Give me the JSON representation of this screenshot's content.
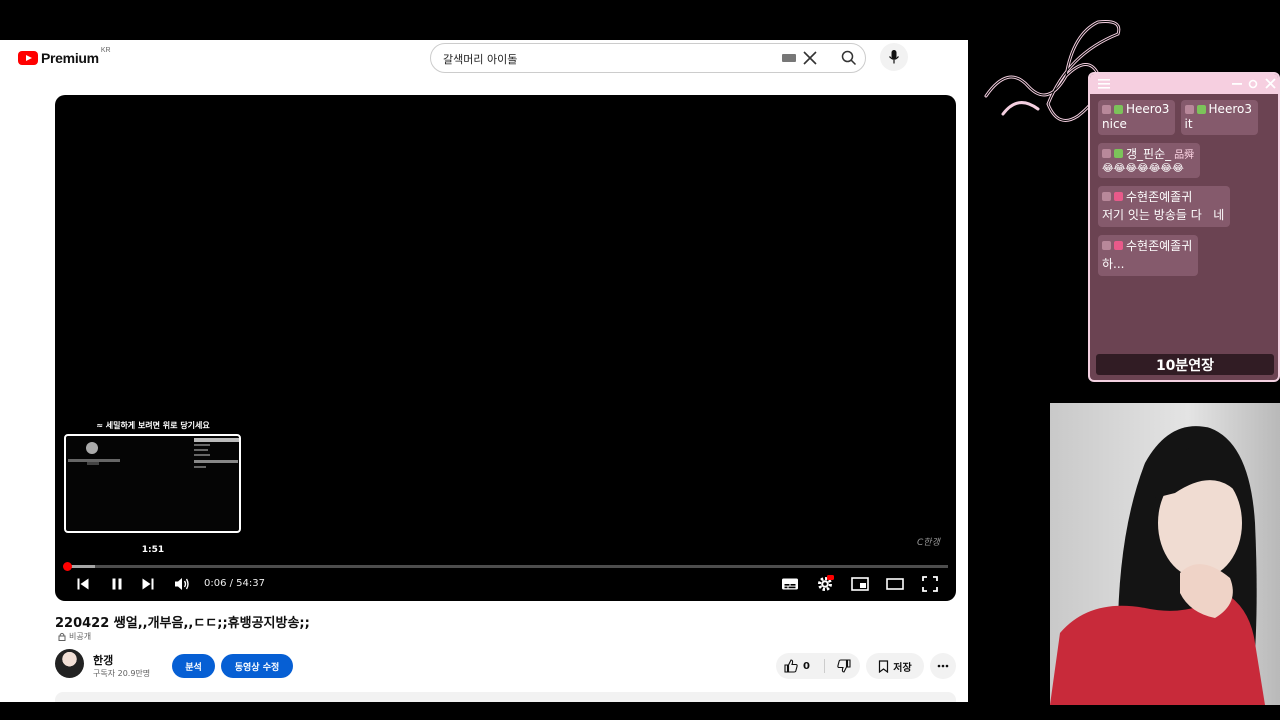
{
  "header": {
    "logo_text": "Premium",
    "logo_region": "KR",
    "search_value": "갈색머리 아이돌"
  },
  "player": {
    "hint": "≈ 세밀하게 보려면 위로 당기세요",
    "preview_time": "1:51",
    "watermark": "C한갱",
    "time": "0:06 / 54:37",
    "progress_fraction": 0.0018,
    "buffered_fraction": 0.034
  },
  "video": {
    "title": "220422 쌩얼,,개부음,,ㄷㄷ;;휴뱅공지방송;;",
    "privacy": "비공개",
    "channel_name": "한갱",
    "subscribers": "구독자 20.9만명",
    "analytics_label": "분석",
    "edit_label": "동영상 수정",
    "like_count": "0",
    "save_label": "저장"
  },
  "chat": {
    "messages": [
      {
        "user": "Heero3",
        "text": "nice",
        "badge_color": "#7cc35a"
      },
      {
        "user": "Heero3",
        "text": "it",
        "badge_color": "#7cc35a"
      },
      {
        "user": "갱_핀순_",
        "user_suffix": "品舜",
        "text": "😂😂😂😂😂😂😂",
        "badge_color": "#7cc35a"
      },
      {
        "user": "수현존예졸귀",
        "text": "저기 잇는 방송들 다   네",
        "badge_color": "#e85a8a"
      },
      {
        "user": "수현존예졸귀",
        "text": "하...",
        "badge_color": "#e85a8a"
      }
    ],
    "extend_label": "10분연장"
  },
  "colors": {
    "brand_red": "#ff0000",
    "button_blue": "#065fd4",
    "chat_bg": "#6b4352",
    "chat_border": "#f3d1e1"
  }
}
